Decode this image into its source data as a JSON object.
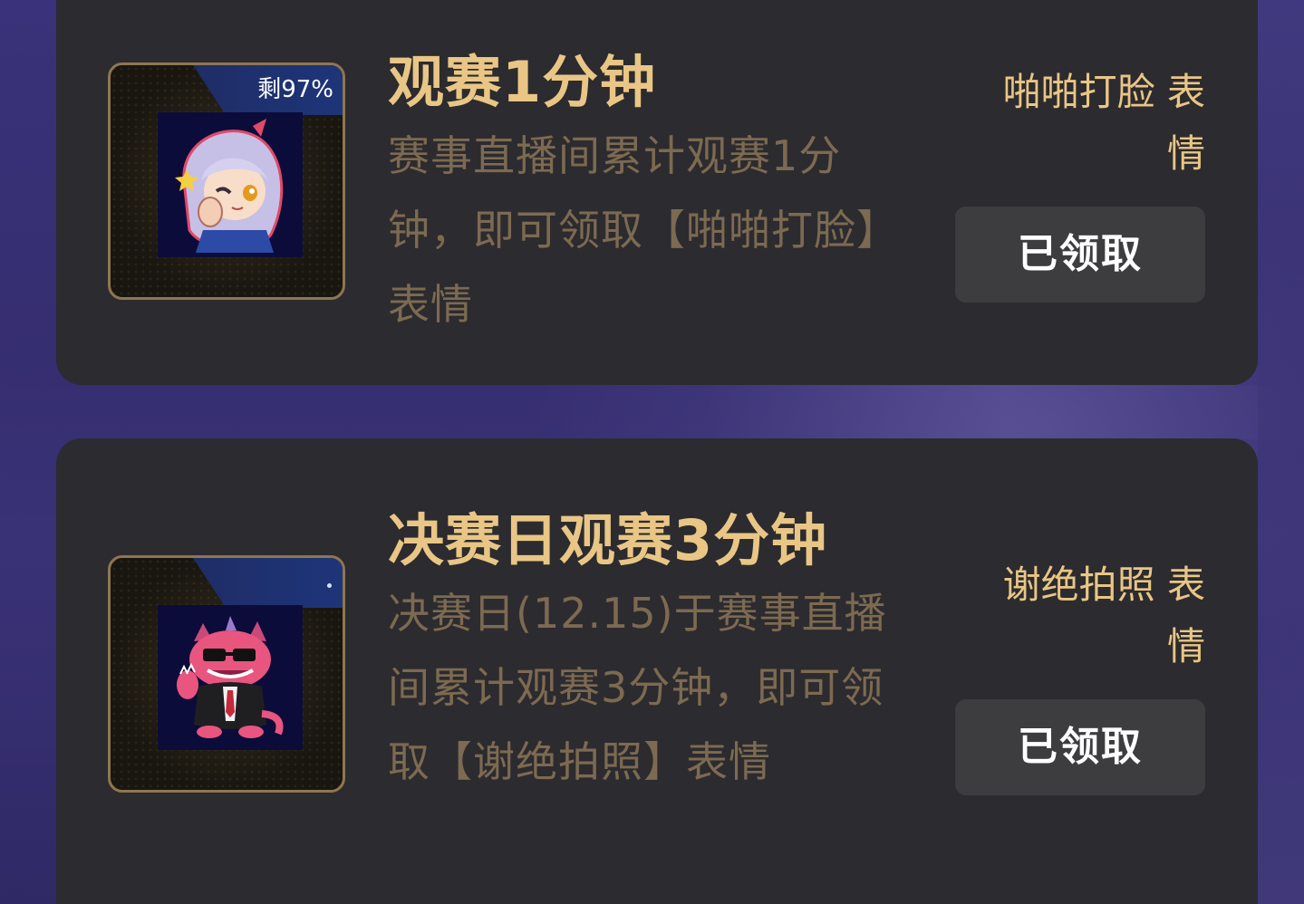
{
  "tasks": [
    {
      "title": "观赛1分钟",
      "description": "赛事直播间累计观赛1分钟，即可领取【啪啪打脸】表情",
      "badge": "剩97%",
      "reward": "啪啪打脸 表情",
      "button_label": "已领取",
      "emote_icon": "slap-face-emote-icon"
    },
    {
      "title": "决赛日观赛3分钟",
      "description": "决赛日(12.15)于赛事直播间累计观赛3分钟，即可领取【谢绝拍照】表情",
      "badge": "",
      "reward": "谢绝拍照 表情",
      "button_label": "已领取",
      "emote_icon": "no-photos-emote-icon"
    }
  ],
  "colors": {
    "background": "#362f72",
    "card": "#2c2b2f",
    "title_gold": "#e9c685",
    "description_muted_gold": "#7c6a51",
    "button_bg": "#3d3d40",
    "badge_blue": "#1f2d66"
  }
}
